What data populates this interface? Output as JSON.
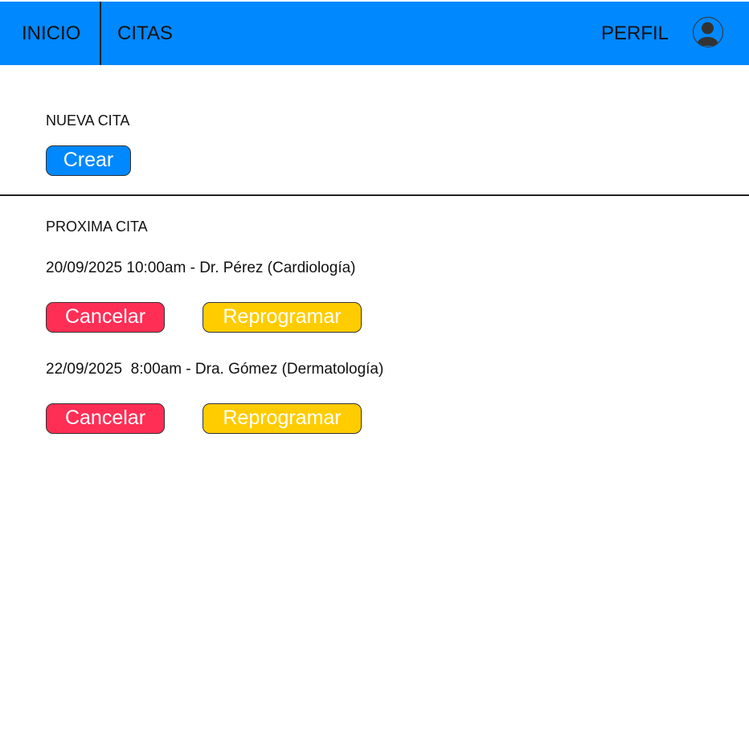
{
  "nav": {
    "inicio": "INICIO",
    "citas": "CITAS",
    "perfil": "PERFIL",
    "avatar_icon": "user-avatar-icon"
  },
  "new_appointment": {
    "title": "NUEVA CITA",
    "create_label": "Crear"
  },
  "upcoming": {
    "title": "PROXIMA CITA",
    "appointments": [
      {
        "text": "20/09/2025 10:00am - Dr. Pérez (Cardiología)",
        "cancel_label": "Cancelar",
        "reschedule_label": "Reprogramar"
      },
      {
        "text": "22/09/2025  8:00am - Dra. Gómez (Dermatología)",
        "cancel_label": "Cancelar",
        "reschedule_label": "Reprogramar"
      }
    ]
  },
  "colors": {
    "primary": "#0088ff",
    "danger": "#ff2e55",
    "warning": "#ffcc00",
    "text": "#111111"
  }
}
